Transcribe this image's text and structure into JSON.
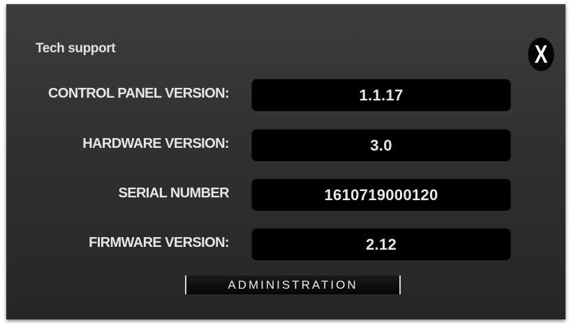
{
  "dialog": {
    "title": "Tech support",
    "close_label": "X"
  },
  "fields": {
    "control_panel_version": {
      "label": "CONTROL PANEL VERSION:",
      "value": "1.1.17"
    },
    "hardware_version": {
      "label": "HARDWARE VERSION:",
      "value": "3.0"
    },
    "serial_number": {
      "label": "SERIAL NUMBER",
      "value": "1610719000120"
    },
    "firmware_version": {
      "label": "FIRMWARE VERSION:",
      "value": "2.12"
    }
  },
  "actions": {
    "administration_label": "ADMINISTRATION"
  }
}
